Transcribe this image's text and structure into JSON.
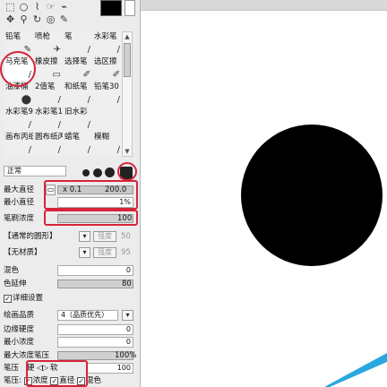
{
  "tools_row1": [
    "⬚",
    "○",
    "⌇",
    "☞",
    "⌁"
  ],
  "tools_row2": [
    "✥",
    "⚲",
    "↻",
    "◎",
    "✎"
  ],
  "brushes": [
    {
      "label": "铅笔",
      "icon": "✎"
    },
    {
      "label": "喷枪",
      "icon": "✈"
    },
    {
      "label": "笔",
      "icon": "/"
    },
    {
      "label": "水彩笔",
      "icon": "/"
    },
    {
      "label": "马克笔",
      "icon": "/"
    },
    {
      "label": "橡皮擦",
      "icon": "▭"
    },
    {
      "label": "选择笔",
      "icon": "✐"
    },
    {
      "label": "选区擦",
      "icon": "✐"
    },
    {
      "label": "油漆桶",
      "icon": "⬤"
    },
    {
      "label": "2值笔",
      "icon": "/"
    },
    {
      "label": "和纸笔",
      "icon": "/"
    },
    {
      "label": "铅笔30",
      "icon": "/"
    },
    {
      "label": "水彩笔9版",
      "icon": "/"
    },
    {
      "label": "水彩笔10版",
      "icon": "/"
    },
    {
      "label": "旧水彩",
      "icon": "/"
    },
    {
      "label": "",
      "icon": ""
    },
    {
      "label": "画布丙纸",
      "icon": "/"
    },
    {
      "label": "圆布纸丙纸",
      "icon": "/"
    },
    {
      "label": "蜡笔",
      "icon": "/"
    },
    {
      "label": "模糊",
      "icon": "/"
    }
  ],
  "blend_mode": "正常",
  "max_diameter": {
    "label": "最大直径",
    "mult": "x 0.1",
    "value": "200.0"
  },
  "min_diameter": {
    "label": "最小直径",
    "value": "1%"
  },
  "brush_density": {
    "label": "笔刷浓度",
    "value": "100"
  },
  "shape_select": "【通常的圆形】",
  "shape_value": "50",
  "shape_btn": "强度",
  "texture_select": "【无材质】",
  "texture_value": "95",
  "texture_btn": "强度",
  "blend": {
    "label": "混色",
    "value": "0"
  },
  "color_extend": {
    "label": "色延伸",
    "value": "80"
  },
  "detail_settings": "详细设置",
  "quality": {
    "label": "绘画品质",
    "value": "4（品质优先）"
  },
  "edge_hardness": {
    "label": "边缘硬度",
    "value": "0"
  },
  "min_density": {
    "label": "最小浓度",
    "value": "0"
  },
  "max_density_pressure": {
    "label": "最大浓度笔压",
    "value": "100%"
  },
  "pressure_hardsoft": {
    "label": "笔压",
    "mid": "硬",
    "mid2": "软",
    "value": "100"
  },
  "pressure_opts": {
    "label": "笔压:",
    "opt1": "浓度",
    "opt2": "直径",
    "opt3": "混色"
  },
  "colors": {
    "highlight": "#d6243a",
    "accent": "#29a8e0"
  }
}
